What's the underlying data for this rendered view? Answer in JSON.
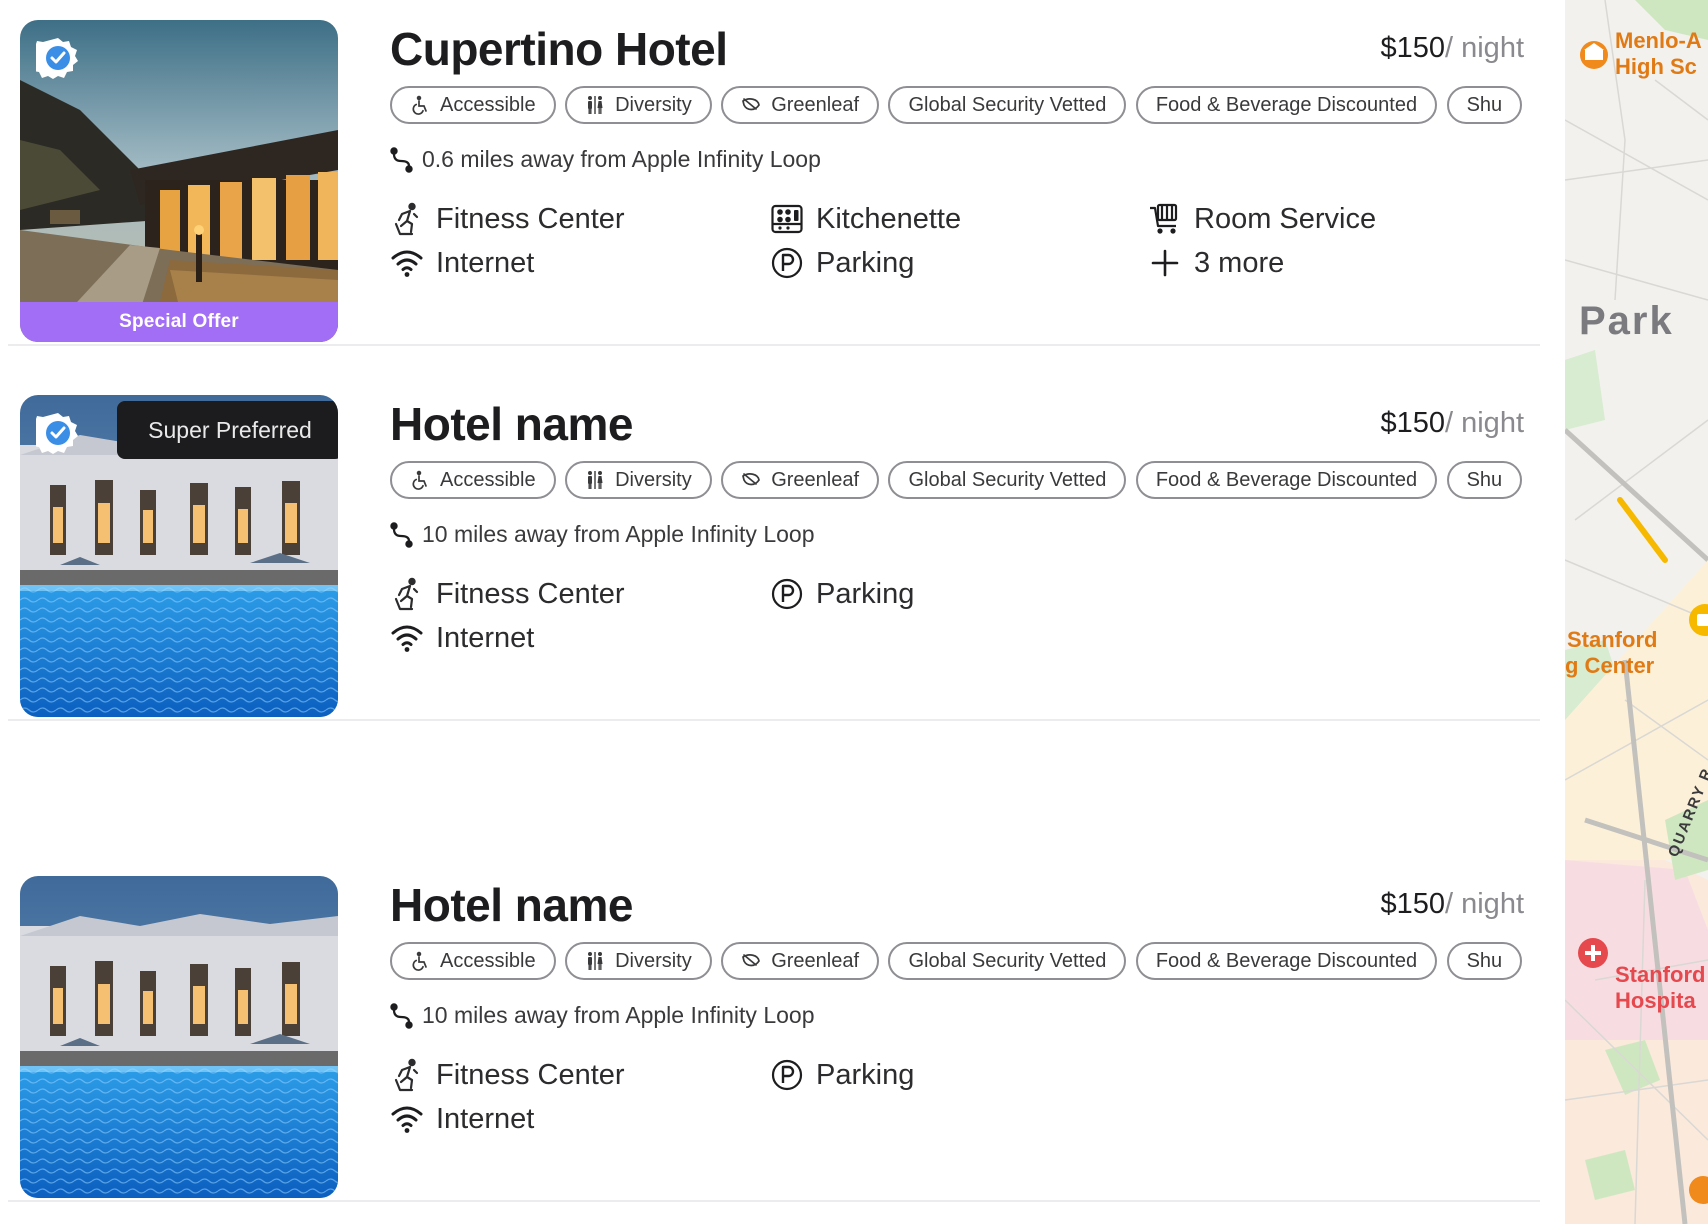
{
  "hotels": [
    {
      "name": "Cupertino Hotel",
      "price": "$150",
      "price_unit": "/ night",
      "special_offer": "Special Offer",
      "badge_tooltip": "",
      "tags": [
        "Accessible",
        "Diversity",
        "Greenleaf",
        "Global Security Vetted",
        "Food & Beverage Discounted",
        "Shu"
      ],
      "distance": "0.6 miles away from Apple Infinity Loop",
      "amenities": [
        "Fitness Center",
        "Internet",
        "Kitchenette",
        "Parking",
        "Room Service",
        "3 more"
      ]
    },
    {
      "name": "Hotel name",
      "price": "$150",
      "price_unit": "/ night",
      "special_offer": "",
      "badge_tooltip": "Super Preferred",
      "tags": [
        "Accessible",
        "Diversity",
        "Greenleaf",
        "Global Security Vetted",
        "Food & Beverage Discounted",
        "Shu"
      ],
      "distance": "10 miles away from Apple Infinity Loop",
      "amenities": [
        "Fitness Center",
        "Internet",
        "Parking"
      ]
    },
    {
      "name": "Hotel name",
      "price": "$150",
      "price_unit": "/ night",
      "special_offer": "",
      "badge_tooltip": "",
      "tags": [
        "Accessible",
        "Diversity",
        "Greenleaf",
        "Global Security Vetted",
        "Food & Beverage Discounted",
        "Shu"
      ],
      "distance": "10 miles away from Apple Infinity Loop",
      "amenities": [
        "Fitness Center",
        "Internet",
        "Parking"
      ]
    }
  ],
  "map": {
    "labels": [
      "Menlo-A",
      "High Sc",
      "Park",
      "Stanford",
      "g Center",
      "QUARRY R",
      "Stanford",
      "Hospita"
    ]
  },
  "colors": {
    "offer_purple": "#a26ef5",
    "verified_blue": "#3a8ee6",
    "map_orange": "#f08a1c",
    "map_red": "#e5484d"
  },
  "icons": {
    "tags": [
      "accessible-icon",
      "diversity-icon",
      "greenleaf-icon",
      "shield-icon",
      "food-icon",
      "shuttle-icon"
    ],
    "amenities": [
      "fitness-icon",
      "wifi-icon",
      "kitchenette-icon",
      "parking-icon",
      "room-service-icon",
      "plus-icon"
    ]
  }
}
